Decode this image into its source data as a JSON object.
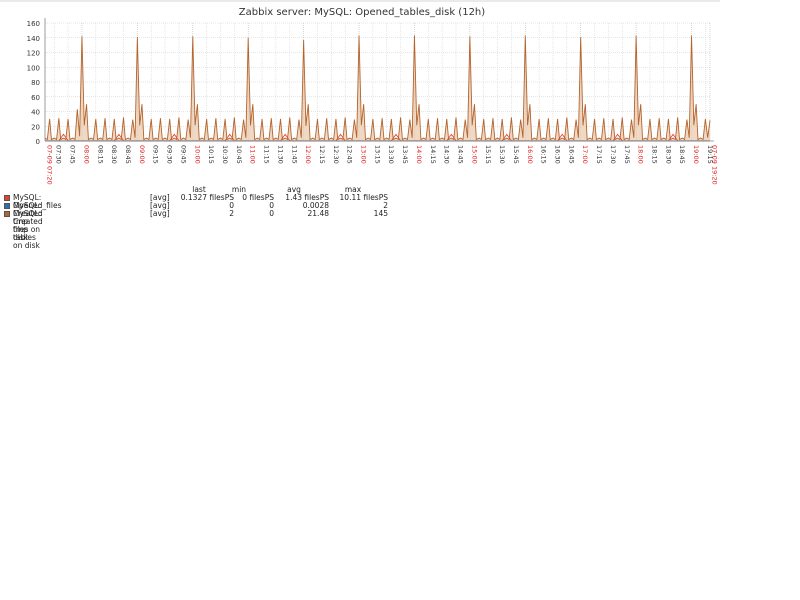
{
  "chart_data": {
    "type": "line",
    "title": "Zabbix server: MySQL: Opened_tables_disk (12h)",
    "ylim": [
      0,
      160
    ],
    "yticks": [
      "0",
      "20",
      "40",
      "60",
      "80",
      "100",
      "120",
      "140",
      "160"
    ],
    "start": "07:20",
    "end": "19:20",
    "sample_minutes": 5,
    "xticks": [
      {
        "label": "07-09 07:20",
        "min": 0,
        "major": true
      },
      {
        "label": "07:30",
        "min": 10
      },
      {
        "label": "07:45",
        "min": 25
      },
      {
        "label": "08:00",
        "min": 40,
        "major": true
      },
      {
        "label": "08:15",
        "min": 55
      },
      {
        "label": "08:30",
        "min": 70
      },
      {
        "label": "08:45",
        "min": 85
      },
      {
        "label": "09:00",
        "min": 100,
        "major": true
      },
      {
        "label": "09:15",
        "min": 115
      },
      {
        "label": "09:30",
        "min": 130
      },
      {
        "label": "09:45",
        "min": 145
      },
      {
        "label": "10:00",
        "min": 160,
        "major": true
      },
      {
        "label": "10:15",
        "min": 175
      },
      {
        "label": "10:30",
        "min": 190
      },
      {
        "label": "10:45",
        "min": 205
      },
      {
        "label": "11:00",
        "min": 220,
        "major": true
      },
      {
        "label": "11:15",
        "min": 235
      },
      {
        "label": "11:30",
        "min": 250
      },
      {
        "label": "11:45",
        "min": 265
      },
      {
        "label": "12:00",
        "min": 280,
        "major": true
      },
      {
        "label": "12:15",
        "min": 295
      },
      {
        "label": "12:30",
        "min": 310
      },
      {
        "label": "12:45",
        "min": 325
      },
      {
        "label": "13:00",
        "min": 340,
        "major": true
      },
      {
        "label": "13:15",
        "min": 355
      },
      {
        "label": "13:30",
        "min": 370
      },
      {
        "label": "13:45",
        "min": 385
      },
      {
        "label": "14:00",
        "min": 400,
        "major": true
      },
      {
        "label": "14:15",
        "min": 415
      },
      {
        "label": "14:30",
        "min": 430
      },
      {
        "label": "14:45",
        "min": 445
      },
      {
        "label": "15:00",
        "min": 460,
        "major": true
      },
      {
        "label": "15:15",
        "min": 475
      },
      {
        "label": "15:30",
        "min": 490
      },
      {
        "label": "15:45",
        "min": 505
      },
      {
        "label": "16:00",
        "min": 520,
        "major": true
      },
      {
        "label": "16:15",
        "min": 535
      },
      {
        "label": "16:30",
        "min": 550
      },
      {
        "label": "16:45",
        "min": 565
      },
      {
        "label": "17:00",
        "min": 580,
        "major": true
      },
      {
        "label": "17:15",
        "min": 595
      },
      {
        "label": "17:30",
        "min": 610
      },
      {
        "label": "17:45",
        "min": 625
      },
      {
        "label": "18:00",
        "min": 640,
        "major": true
      },
      {
        "label": "18:15",
        "min": 655
      },
      {
        "label": "18:30",
        "min": 670
      },
      {
        "label": "18:45",
        "min": 685
      },
      {
        "label": "19:00",
        "min": 700,
        "major": true
      },
      {
        "label": "19:15",
        "min": 715
      },
      {
        "label": "07-09 19:20",
        "min": 720,
        "major": true
      }
    ],
    "series": [
      {
        "name": "MySQL: Created tmp tables on disk",
        "color": "#b4642d",
        "fill": "#e8c9ad",
        "values": [
          4,
          30,
          4,
          31,
          4,
          30,
          4,
          43,
          142,
          50,
          4,
          30,
          4,
          31,
          4,
          30,
          4,
          32,
          4,
          29,
          141,
          50,
          4,
          30,
          4,
          31,
          4,
          30,
          4,
          32,
          4,
          29,
          142,
          50,
          4,
          30,
          4,
          31,
          4,
          30,
          4,
          32,
          4,
          29,
          140,
          50,
          4,
          30,
          4,
          31,
          4,
          30,
          4,
          32,
          4,
          29,
          137,
          50,
          4,
          30,
          4,
          31,
          4,
          30,
          4,
          32,
          4,
          29,
          143,
          50,
          4,
          30,
          4,
          31,
          4,
          30,
          4,
          32,
          4,
          29,
          143,
          50,
          4,
          30,
          4,
          31,
          4,
          30,
          4,
          32,
          4,
          29,
          142,
          50,
          4,
          30,
          4,
          31,
          4,
          30,
          4,
          32,
          4,
          29,
          143,
          50,
          4,
          30,
          4,
          31,
          4,
          30,
          4,
          32,
          4,
          29,
          141,
          50,
          4,
          30,
          4,
          31,
          4,
          30,
          4,
          32,
          4,
          29,
          143,
          50,
          4,
          30,
          4,
          31,
          4,
          30,
          4,
          32,
          4,
          29,
          143,
          50,
          4,
          30,
          28
        ]
      },
      {
        "name": "MySQL: Opened_files",
        "color": "#e8402a",
        "peak": 9,
        "base": 0.3
      },
      {
        "name": "MySQL: Created tmp files on disk",
        "color": "#2f6fb0",
        "base": 0
      }
    ]
  },
  "legend": {
    "headers": {
      "last": "last",
      "min": "min",
      "avg": "avg",
      "max": "max"
    },
    "rows": [
      {
        "name": "MySQL: Opened_files",
        "fn": "[avg]",
        "last": "0.1327 filesPS",
        "min": "0 filesPS",
        "avg": "1.43 filesPS",
        "max": "10.11 filesPS",
        "color": "#e8402a"
      },
      {
        "name": "MySQL: Created tmp files on disk",
        "fn": "[avg]",
        "last": "0",
        "min": "0",
        "avg": "0.0028",
        "max": "2",
        "color": "#2f6fb0"
      },
      {
        "name": "MySQL: Created tmp tables on disk",
        "fn": "[avg]",
        "last": "2",
        "min": "0",
        "avg": "21.48",
        "max": "145",
        "color": "#b4642d"
      }
    ]
  }
}
